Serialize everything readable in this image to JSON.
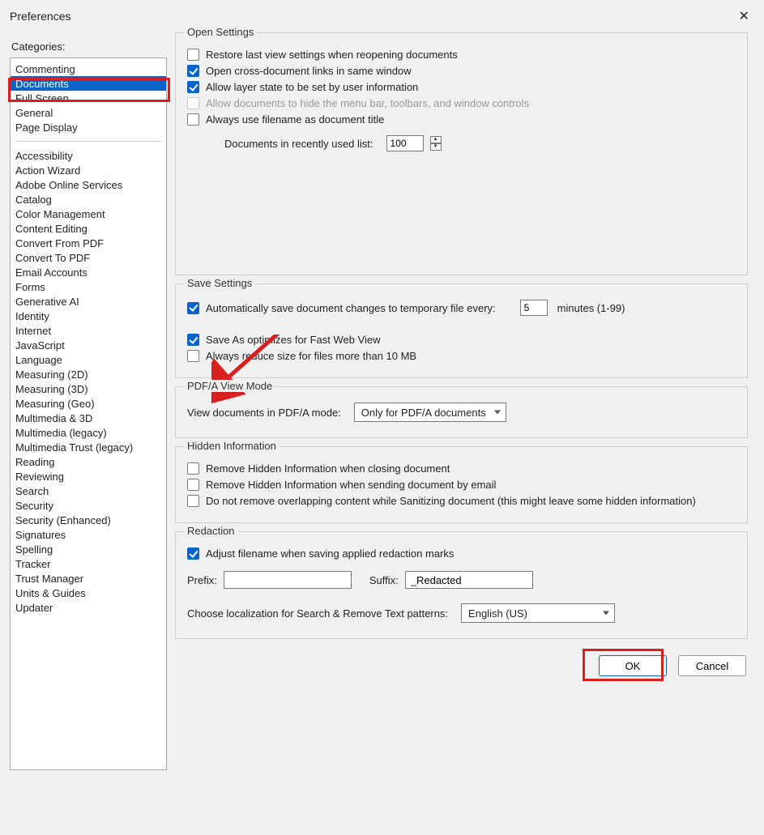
{
  "titlebar": {
    "title": "Preferences"
  },
  "sidebar": {
    "label": "Categories:",
    "group1": [
      "Commenting",
      "Documents",
      "Full Screen",
      "General",
      "Page Display"
    ],
    "selected": "Documents",
    "group2": [
      "Accessibility",
      "Action Wizard",
      "Adobe Online Services",
      "Catalog",
      "Color Management",
      "Content Editing",
      "Convert From PDF",
      "Convert To PDF",
      "Email Accounts",
      "Forms",
      "Generative AI",
      "Identity",
      "Internet",
      "JavaScript",
      "Language",
      "Measuring (2D)",
      "Measuring (3D)",
      "Measuring (Geo)",
      "Multimedia & 3D",
      "Multimedia (legacy)",
      "Multimedia Trust (legacy)",
      "Reading",
      "Reviewing",
      "Search",
      "Security",
      "Security (Enhanced)",
      "Signatures",
      "Spelling",
      "Tracker",
      "Trust Manager",
      "Units & Guides",
      "Updater"
    ]
  },
  "open": {
    "legend": "Open Settings",
    "restore": "Restore last view settings when reopening documents",
    "cross_doc": "Open cross-document links in same window",
    "layer": "Allow layer state to be set by user information",
    "hide_menu": "Allow documents to hide the menu bar, toolbars, and window controls",
    "filename_title": "Always use filename as document title",
    "recent_label": "Documents in recently used list:",
    "recent_value": "100"
  },
  "save": {
    "legend": "Save Settings",
    "auto_save": "Automatically save document changes to temporary file every:",
    "auto_value": "5",
    "auto_suffix": "minutes (1-99)",
    "fast_web": "Save As optimizes for Fast Web View",
    "reduce": "Always reduce size for files more than 10 MB"
  },
  "pdfa": {
    "legend": "PDF/A View Mode",
    "label": "View documents in PDF/A mode:",
    "value": "Only for PDF/A documents"
  },
  "hidden": {
    "legend": "Hidden Information",
    "close": "Remove Hidden Information when closing document",
    "email": "Remove Hidden Information when sending document by email",
    "overlap": "Do not remove overlapping content while Sanitizing document (this might leave some hidden information)"
  },
  "redaction": {
    "legend": "Redaction",
    "adjust": "Adjust filename when saving applied redaction marks",
    "prefix_label": "Prefix:",
    "prefix_value": "",
    "suffix_label": "Suffix:",
    "suffix_value": "_Redacted",
    "loc_label": "Choose localization for Search & Remove Text patterns:",
    "loc_value": "English (US)"
  },
  "footer": {
    "ok": "OK",
    "cancel": "Cancel"
  }
}
